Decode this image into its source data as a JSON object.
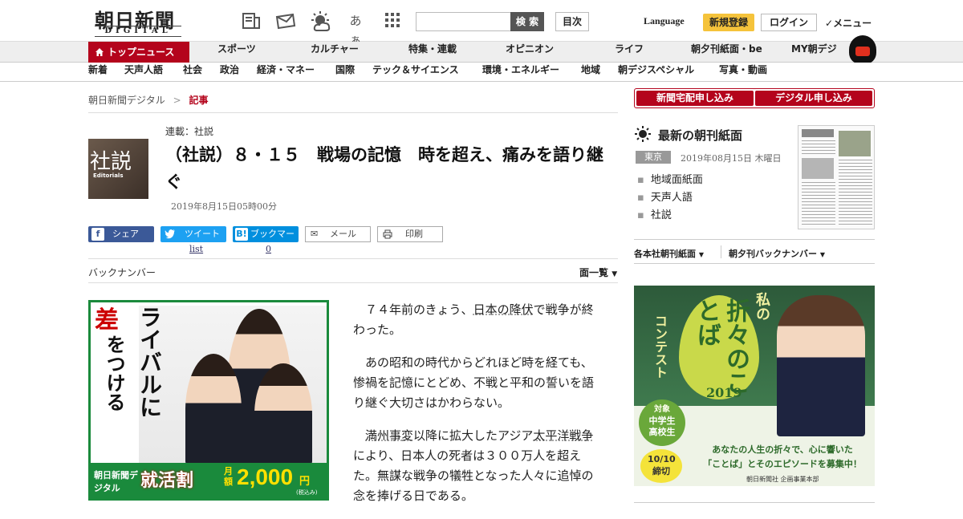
{
  "header": {
    "logo_jp": "朝日新聞",
    "logo_en": "DIGITAL",
    "search_button": "検 索",
    "mokuji_button": "目次",
    "fontsize_label": "あぁ",
    "language": "Language",
    "register": "新規登録",
    "login": "ログイン",
    "menu": "メニュー"
  },
  "nav1": {
    "top_news": "トップニュース",
    "items": [
      "スポーツ",
      "カルチャー",
      "特集・連載",
      "オピニオン",
      "ライフ",
      "朝夕刊紙面・be",
      "MY朝デジ"
    ]
  },
  "nav2": {
    "items": [
      "新着",
      "天声人語",
      "社会",
      "政治",
      "経済・マネー",
      "国際",
      "テック＆サイエンス",
      "環境・エネルギー",
      "地域",
      "朝デジスペシャル",
      "写真・動画"
    ]
  },
  "breadcrumb": {
    "home": "朝日新聞デジタル",
    "sep": ">",
    "current": "記事"
  },
  "article": {
    "thumb_kanji": "社説",
    "thumb_en": "Editorials",
    "series": "連載：社説",
    "title": "（社説）８・１５　戦場の記憶　時を超え、痛みを語り継ぐ",
    "date": "2019年8月15日05時00分",
    "share": {
      "facebook": "シェア",
      "twitter": "ツイート",
      "hatena": "ブックマーク",
      "mail": "メール",
      "print": "印刷",
      "twitter_count": "list",
      "hatena_count": "0"
    },
    "back_number": "バックナンバー",
    "menlist": "面一覧",
    "paragraphs": [
      {
        "pre": "７４年前のきょう、",
        "link": "日本の降伏",
        "post": "で戦争が終わった。"
      },
      {
        "pre": "あの昭和の時代からどれほど時を経ても、惨禍を記憶にとどめ、不戦と平和の誓いを語り継ぐ大切さはかわらない。",
        "link": "",
        "post": ""
      },
      {
        "pre": "",
        "link": "満州事変",
        "mid": "以降に拡大したアジア",
        "link2": "太平洋戦争",
        "post": "により、日本人の死者は３００万人を超えた。無謀な戦争の犠牲となった人々に追悼の念を捧げる日である。"
      }
    ]
  },
  "ad_left": {
    "vertical": "ライバルに",
    "vertical_red": "差",
    "vertical2": "をつける",
    "brand": "朝日新聞デジタル",
    "campaign": "就活割",
    "price_prefix": "月額",
    "price": "2,000",
    "yen": "円",
    "tax": "(税込み)"
  },
  "sidebar": {
    "subscribe_paper": "新聞宅配申し込み",
    "subscribe_digital": "デジタル申し込み",
    "paper_heading": "最新の朝刊紙面",
    "edition": "東京",
    "paper_date": "2019年08月15日 木曜日",
    "links": [
      "地域面紙面",
      "天声人語",
      "社説"
    ],
    "dropdown1": "各本社朝刊紙面",
    "dropdown2": "朝夕刊バックナンバー"
  },
  "ad_right": {
    "t1": "私の",
    "t2": "折々のことば",
    "t3": "コンテスト",
    "year": "2019",
    "target_label": "対象",
    "target": "中学生高校生",
    "deadline": "10/10締切",
    "message1": "あなたの人生の折々で、心に響いた",
    "message2": "「ことば」とそのエピソードを募集中！",
    "org": "朝日新聞社 企画事業本部"
  }
}
